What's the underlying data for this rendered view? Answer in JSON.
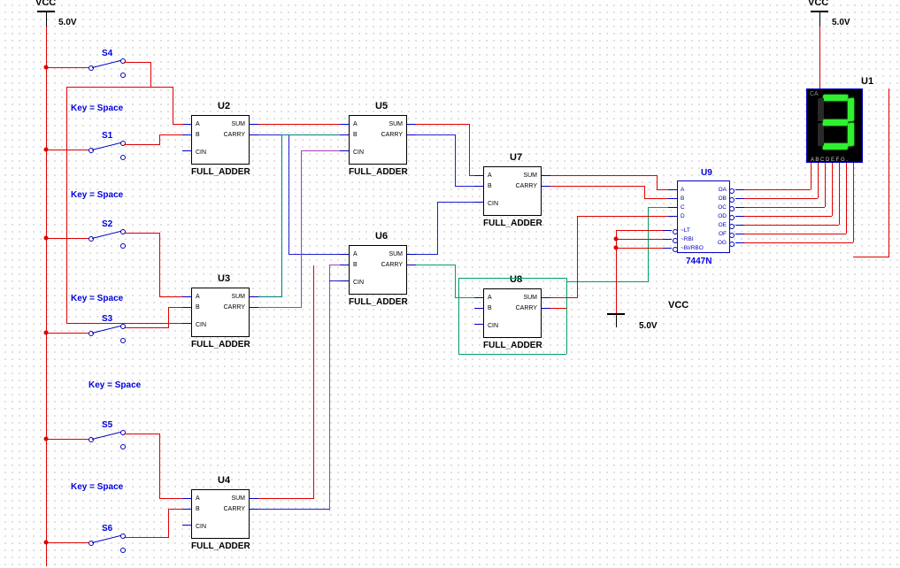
{
  "power": {
    "vcc_label": "VCC",
    "volt_label": "5.0V"
  },
  "adder": {
    "part": "FULL_ADDER",
    "pin_a": "A",
    "pin_b": "B",
    "pin_cin": "CIN",
    "pin_sum": "SUM",
    "pin_carry": "CARRY"
  },
  "decoder": {
    "ref": "U9",
    "part": "7447N",
    "pin_a": "A",
    "pin_b": "B",
    "pin_c": "C",
    "pin_d": "D",
    "pin_lt": "~LT",
    "pin_rbi": "~RBI",
    "pin_birbo": "~BI/RBO",
    "pin_oa": "OA",
    "pin_ob": "OB",
    "pin_oc": "OC",
    "pin_od": "OD",
    "pin_oe": "OE",
    "pin_of": "OF",
    "pin_og": "OG"
  },
  "display": {
    "ref": "U1",
    "ca": "CA",
    "digit_shown": "3",
    "segments_on": [
      "a",
      "b",
      "c",
      "d",
      "g"
    ],
    "pins": "A B C D E F G ."
  },
  "refs": {
    "u2": "U2",
    "u3": "U3",
    "u4": "U4",
    "u5": "U5",
    "u6": "U6",
    "u7": "U7",
    "u8": "U8"
  },
  "switch_labels": {
    "s1": "S1",
    "s2": "S2",
    "s3": "S3",
    "s4": "S4",
    "s5": "S5",
    "s6": "S6"
  },
  "key_text": "Key = Space"
}
